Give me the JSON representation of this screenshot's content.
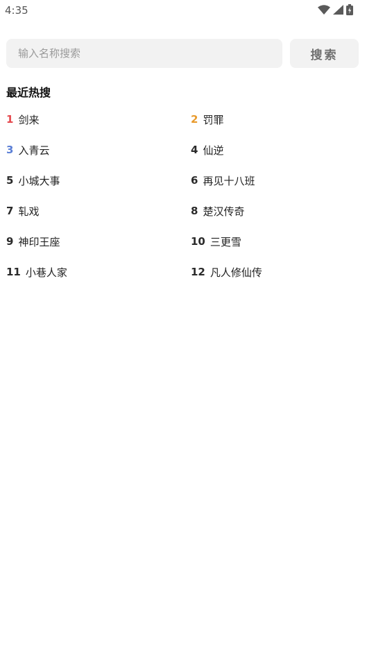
{
  "status_bar": {
    "time": "4:35",
    "icons": [
      "wifi-icon",
      "cell-signal-icon",
      "battery-charging-icon"
    ]
  },
  "search": {
    "placeholder": "输入名称搜索",
    "value": "",
    "button_label": "搜索"
  },
  "section_title": "最近热搜",
  "colors": {
    "rank1": "#e5484d",
    "rank2": "#e89a2c",
    "rank3": "#5b7fd6",
    "rank_default": "#2a2a2a"
  },
  "hot_searches": [
    {
      "rank": "1",
      "name": "剑来"
    },
    {
      "rank": "2",
      "name": "罚罪"
    },
    {
      "rank": "3",
      "name": "入青云"
    },
    {
      "rank": "4",
      "name": "仙逆"
    },
    {
      "rank": "5",
      "name": "小城大事"
    },
    {
      "rank": "6",
      "name": "再见十八班"
    },
    {
      "rank": "7",
      "name": "轧戏"
    },
    {
      "rank": "8",
      "name": "楚汉传奇"
    },
    {
      "rank": "9",
      "name": "神印王座"
    },
    {
      "rank": "10",
      "name": "三更雪"
    },
    {
      "rank": "11",
      "name": "小巷人家"
    },
    {
      "rank": "12",
      "name": "凡人修仙传"
    }
  ]
}
